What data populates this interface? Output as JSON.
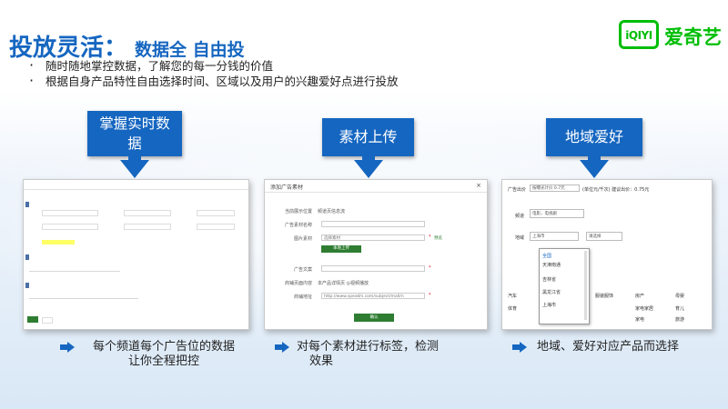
{
  "header": {
    "title": "投放灵活：",
    "subtitle": "数据全 自由投"
  },
  "bullets": [
    "随时随地掌控数据，了解您的每一分钱的价值",
    "根据自身产品特性自由选择时间、区域以及用户的兴趣爱好点进行投放"
  ],
  "logo": {
    "mark": "iQIYI",
    "text": "爱奇艺"
  },
  "columns": [
    {
      "label_line1": "掌握实时数",
      "label_line2": "据",
      "caption_line1": "每个频道每个广告位的数据",
      "caption_line2": "让你全程把控"
    },
    {
      "label_line1": "素材上传",
      "caption_line1": "对每个素材进行标签，检测",
      "caption_line2": "效果"
    },
    {
      "label_line1": "地域爱好",
      "caption_line1": "地域、爱好对应产品而选择"
    }
  ],
  "upload_dialog": {
    "title": "添加广告素材",
    "fields": [
      {
        "label": "当前展示位置",
        "value": "频道页信息流"
      },
      {
        "label": "广告素材名称",
        "value": ""
      },
      {
        "label": "图片素材",
        "value": "选择素材"
      },
      {
        "label": "广告文案",
        "value": ""
      },
      {
        "label": "商铺页面内容",
        "value": "本产品详情页 ◎视频播放"
      },
      {
        "label": "商铺地址",
        "value": "http://www.speakhi.com/subject/mall/n"
      }
    ],
    "preview_label": "预览",
    "upload_button": "本地上传",
    "confirm_button": "确认"
  },
  "region_panel": {
    "budget_label": "广告出价",
    "budget_value": "按曝光计价 0.7元",
    "budget_note": "(单位元/千次) 建议出价：0.75元",
    "channel_label": "频道",
    "channel_value": "电影，电视剧",
    "region_label": "地域",
    "region_value": "上海市",
    "region_select": "请选择",
    "dropdown_items": [
      "全国",
      "天津南通",
      "吉林省",
      "黑龙江省",
      "上海市"
    ],
    "checkbox_items": [
      "汽车",
      "体育",
      "服装服饰",
      "房产",
      "家电家居",
      "家电",
      "母婴",
      "育儿",
      "旅游"
    ]
  }
}
